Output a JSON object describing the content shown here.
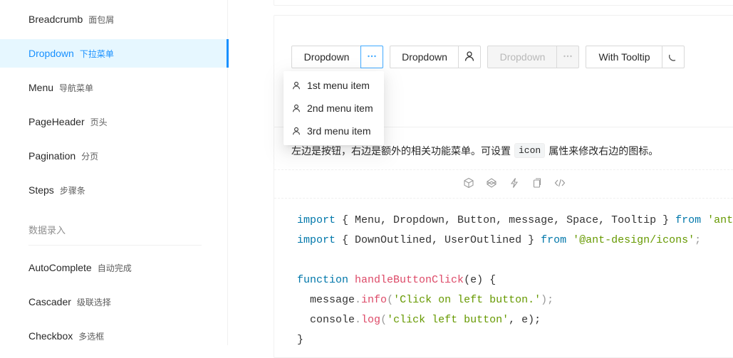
{
  "sidebar": {
    "items": [
      {
        "label": "Breadcrumb",
        "sub": "面包屑"
      },
      {
        "label": "Dropdown",
        "sub": "下拉菜单",
        "active": true
      },
      {
        "label": "Menu",
        "sub": "导航菜单"
      },
      {
        "label": "PageHeader",
        "sub": "页头"
      },
      {
        "label": "Pagination",
        "sub": "分页"
      },
      {
        "label": "Steps",
        "sub": "步骤条"
      }
    ],
    "group_title": "数据录入",
    "items2": [
      {
        "label": "AutoComplete",
        "sub": "自动完成"
      },
      {
        "label": "Cascader",
        "sub": "级联选择"
      },
      {
        "label": "Checkbox",
        "sub": "多选框"
      }
    ]
  },
  "demo": {
    "buttons": {
      "dropdown1": "Dropdown",
      "dropdown2": "Dropdown",
      "dropdown3_disabled": "Dropdown",
      "with_tooltip": "With Tooltip"
    },
    "menu_items": [
      "1st menu item",
      "2nd menu item",
      "3rd menu item"
    ],
    "description": {
      "before": "左边是按钮，右边是额外的相关功能菜单。可设置",
      "code": "icon",
      "after": "属性来修改右边的图标。"
    },
    "action_icons": [
      "codesandbox-icon",
      "codepen-icon",
      "thunderbolt-icon",
      "copy-icon",
      "code-icon"
    ]
  },
  "code": {
    "line1": {
      "kw": "import",
      "names": "{ Menu, Dropdown, Button, message, Space, Tooltip }",
      "from": "from",
      "src": "'antd'",
      "end": ";"
    },
    "line2": {
      "kw": "import",
      "names": "{ DownOutlined, UserOutlined }",
      "from": "from",
      "src": "'@ant-design/icons'",
      "end": ";"
    },
    "line4": {
      "kw": "function",
      "name": "handleButtonClick",
      "params": "(e) {"
    },
    "line5": {
      "obj": "message",
      "method": "info",
      "arg": "'Click on left button.'",
      "end": ");"
    },
    "line6": {
      "obj": "console",
      "method": "log",
      "arg": "'click left button'",
      "rest": ", e);"
    },
    "line7": "}"
  },
  "colors": {
    "primary": "#1890ff",
    "active_bg": "#e6f7ff",
    "border": "#d9d9d9"
  }
}
